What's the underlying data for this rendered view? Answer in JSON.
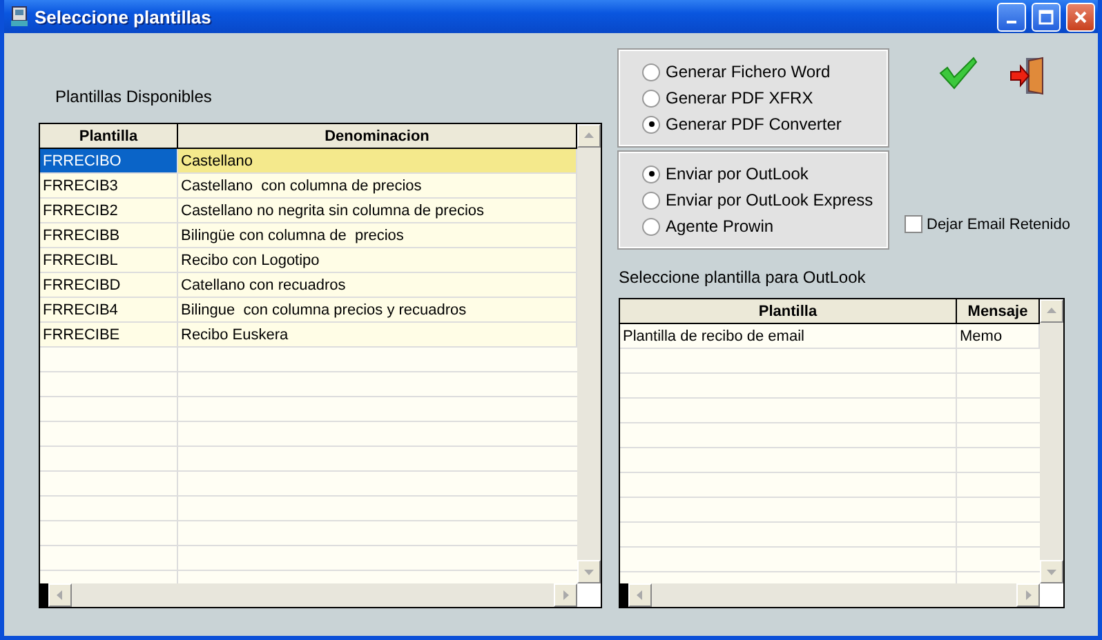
{
  "window": {
    "title": "Seleccione plantillas"
  },
  "templates_label": "Plantillas Disponibles",
  "templates_table": {
    "columns": [
      "Plantilla",
      "Denominacion"
    ],
    "rows": [
      {
        "cells": [
          "FRRECIBO",
          "Castellano"
        ],
        "selected": true
      },
      {
        "cells": [
          "FRRECIB3",
          "Castellano  con columna de precios"
        ],
        "selected": false
      },
      {
        "cells": [
          "FRRECIB2",
          "Castellano no negrita sin columna de precios"
        ],
        "selected": false
      },
      {
        "cells": [
          "FRRECIBB",
          "Bilingüe con columna de  precios"
        ],
        "selected": false
      },
      {
        "cells": [
          "FRRECIBL",
          "Recibo con Logotipo"
        ],
        "selected": false
      },
      {
        "cells": [
          "FRRECIBD",
          "Catellano con recuadros"
        ],
        "selected": false
      },
      {
        "cells": [
          "FRRECIB4",
          "Bilingue  con columna precios y recuadros"
        ],
        "selected": false
      },
      {
        "cells": [
          "FRRECIBE",
          "Recibo Euskera"
        ],
        "selected": false
      }
    ]
  },
  "output_options": [
    {
      "label": "Generar Fichero Word",
      "selected": false
    },
    {
      "label": "Generar PDF XFRX",
      "selected": false
    },
    {
      "label": "Generar PDF Converter",
      "selected": true
    }
  ],
  "send_options": [
    {
      "label": "Enviar por OutLook",
      "selected": true
    },
    {
      "label": "Enviar por OutLook Express",
      "selected": false
    },
    {
      "label": "Agente Prowin",
      "selected": false
    }
  ],
  "retain_email": {
    "label": "Dejar Email Retenido",
    "checked": false
  },
  "outlook_label": "Seleccione plantilla para OutLook",
  "outlook_table": {
    "columns": [
      "Plantilla",
      "Mensaje"
    ],
    "rows": [
      {
        "cells": [
          "Plantilla de recibo de email",
          "Memo"
        ],
        "selected": false
      }
    ]
  }
}
